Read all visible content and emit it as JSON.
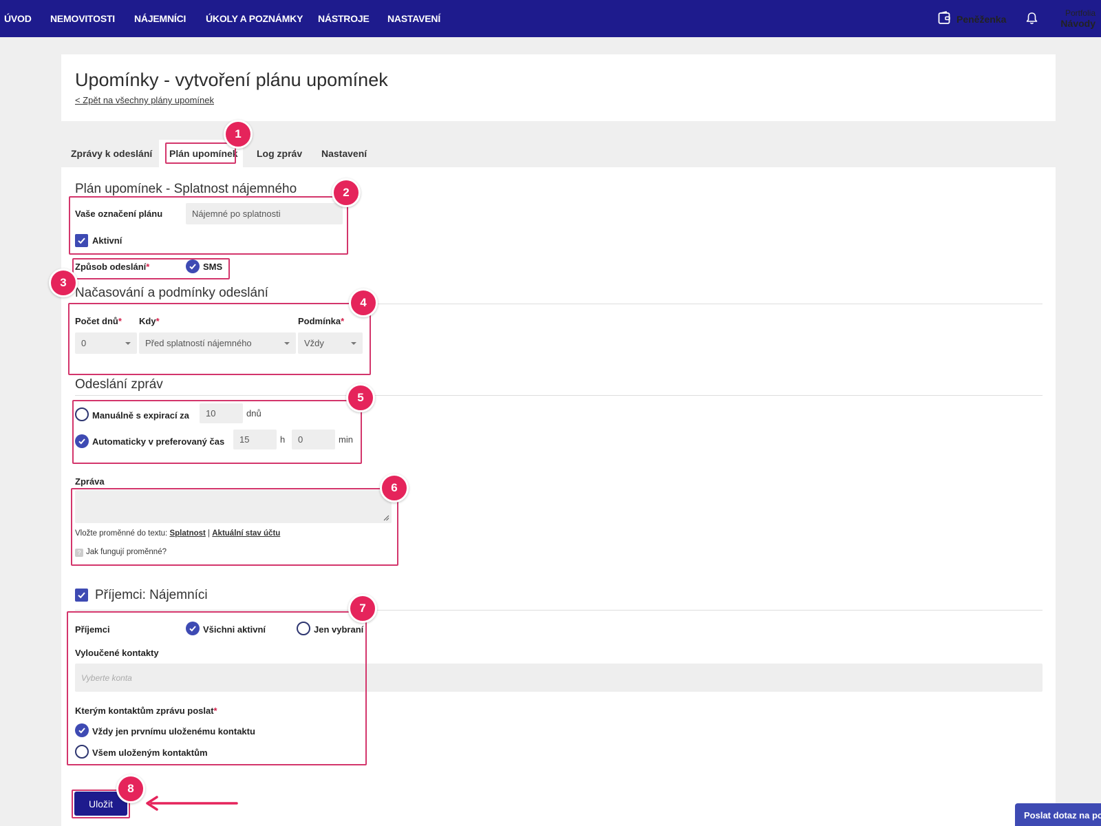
{
  "nav": {
    "items": [
      "ÚVOD",
      "NEMOVITOSTI",
      "NÁJEMNÍCI",
      "ÚKOLY A POZNÁMKY",
      "NÁSTROJE",
      "NASTAVENÍ"
    ],
    "wallet_label": "Peněženka",
    "portfolio_label": "Portfolia",
    "portfolio_value": "Návody"
  },
  "header": {
    "title": "Upomínky - vytvoření plánu upomínek",
    "back_link": "< Zpět na všechny plány upomínek"
  },
  "tabs": [
    "Zprávy k odeslání",
    "Plán upomínek",
    "Log zpráv",
    "Nastavení"
  ],
  "plan": {
    "section_title": "Plán upomínek - Splatnost nájemného",
    "name_label": "Vaše označení plánu",
    "name_value": "Nájemné po splatnosti",
    "active_label": "Aktivní",
    "send_method_label": "Způsob odeslání",
    "send_method_option": "SMS"
  },
  "timing": {
    "section_title": "Načasování a podmínky odeslání",
    "days_label": "Počet dnů",
    "days_value": "0",
    "when_label": "Kdy",
    "when_value": "Před splatností nájemného",
    "condition_label": "Podmínka",
    "condition_value": "Vždy"
  },
  "sending": {
    "section_title": "Odeslání zpráv",
    "manual_label": "Manuálně s expirací za",
    "manual_value": "10",
    "manual_unit": "dnů",
    "auto_label": "Automaticky v preferovaný čas",
    "auto_hours": "15",
    "hours_unit": "h",
    "auto_minutes": "0",
    "minutes_unit": "min"
  },
  "message": {
    "label": "Zpráva",
    "vars_prefix": "Vložte proměnné do textu:",
    "var_due": "Splatnost",
    "separator": "|",
    "var_balance": "Aktuální stav účtu",
    "help_mark": "?",
    "help_text": "Jak fungují proměnné?"
  },
  "recipients": {
    "section_title": "Příjemci: Nájemníci",
    "label": "Příjemci",
    "all_active": "Všichni aktivní",
    "selected_only": "Jen vybraní",
    "excluded_label": "Vyloučené kontakty",
    "excluded_placeholder": "Vyberte konta",
    "which_contacts_label": "Kterým kontaktům zprávu poslat",
    "first_contact": "Vždy jen prvnímu uloženému kontaktu",
    "all_contacts": "Všem uloženým kontaktům"
  },
  "actions": {
    "save": "Uložit",
    "chat": "Poslat dotaz na podporu"
  },
  "annotations": [
    "1",
    "2",
    "3",
    "4",
    "5",
    "6",
    "7",
    "8"
  ],
  "required_mark": "*",
  "colors": {
    "nav_bg": "#1e1b8d",
    "accent": "#3e4ab3",
    "annotation": "#e5245b",
    "required": "#d3214b"
  }
}
